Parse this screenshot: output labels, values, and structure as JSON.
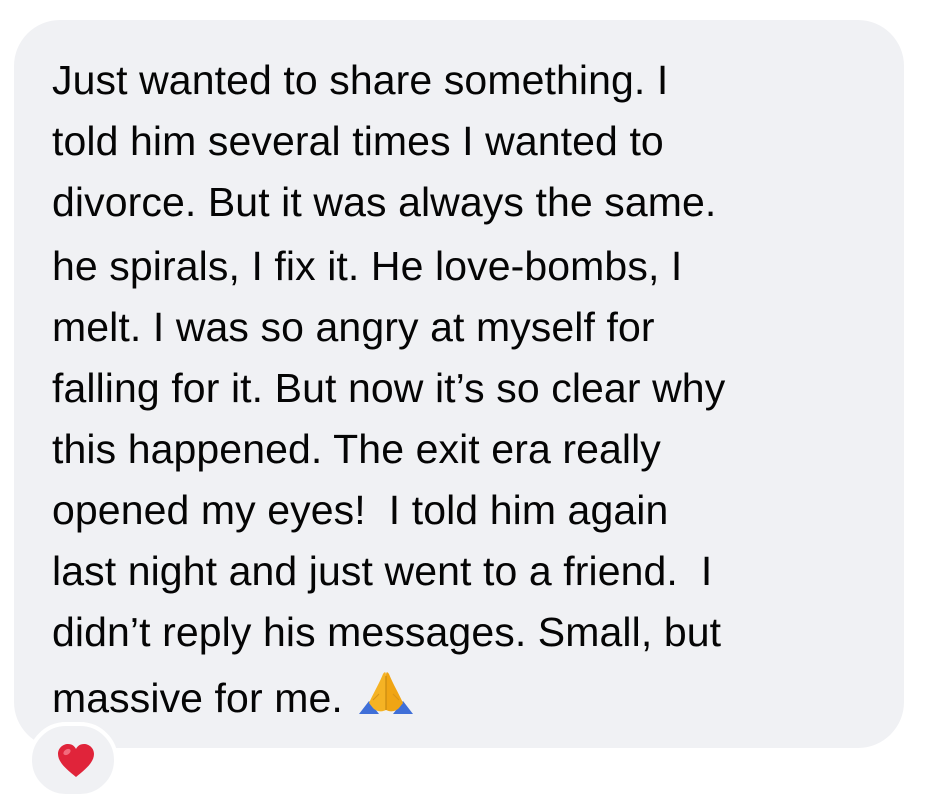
{
  "message": {
    "lines": [
      "Just wanted to share something. I",
      "told him several times I wanted to",
      "divorce. But it was always the same.",
      "he spirals, I fix it. He love-bombs, I",
      "melt. I was so angry at myself for",
      "falling for it. But now it’s so clear why",
      "this happened. The exit era really",
      "opened my eyes!  I told him again",
      "last night and just went to a friend.  I",
      "didn’t reply his messages. Small, but",
      "massive for me."
    ],
    "trailing_icon": "folded-hands-icon"
  },
  "reaction": {
    "icon": "red-heart-icon",
    "color": "#e0243a"
  },
  "colors": {
    "bubble": "#f0f1f4",
    "text": "#050505",
    "background": "#ffffff"
  }
}
